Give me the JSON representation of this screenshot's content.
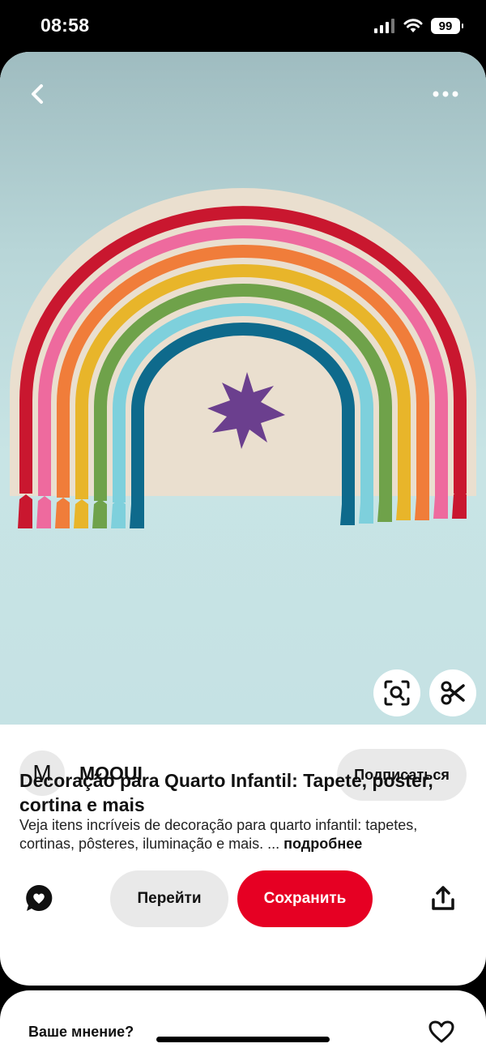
{
  "status_bar": {
    "time": "08:58",
    "battery": "99"
  },
  "pin": {
    "author_initial": "M",
    "author_name": "MOOUI",
    "follow_label": "Подписаться",
    "title": "Decoração para Quarto Infantil: Tapete, poster, cortina e mais",
    "description": "Veja itens incríveis de decoração para quarto infantil: tapetes, cortinas, pôsteres, iluminação e mais. ...",
    "more_label": "подробнее"
  },
  "actions": {
    "go_label": "Перейти",
    "save_label": "Сохранить"
  },
  "feedback": {
    "label": "Ваше мнение?"
  },
  "colors": {
    "save_button": "#e60023",
    "secondary_button": "#e9e9e9",
    "image_background": "#c5e2e4"
  },
  "icons": [
    "back-icon",
    "more-icon",
    "visual-search-icon",
    "scissors-icon",
    "comment-icon",
    "share-icon",
    "heart-icon",
    "signal-icon",
    "wifi-icon",
    "battery-icon"
  ]
}
